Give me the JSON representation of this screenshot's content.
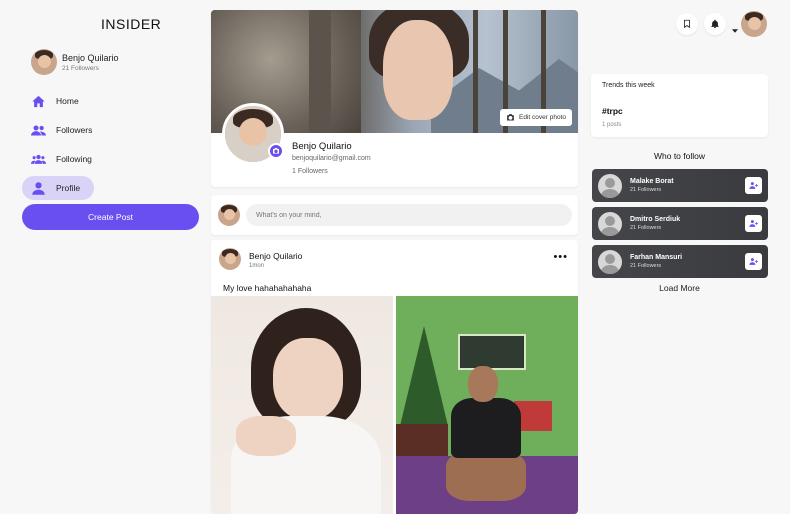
{
  "app": {
    "brand": "INSIDER"
  },
  "me": {
    "name": "Benjo Quilario",
    "followers": "21 Followers"
  },
  "nav": {
    "items": [
      {
        "label": "Home",
        "icon": "home-icon"
      },
      {
        "label": "Followers",
        "icon": "users-icon"
      },
      {
        "label": "Following",
        "icon": "user-group-icon"
      },
      {
        "label": "Profile",
        "icon": "user-icon",
        "active": true
      }
    ],
    "create_label": "Create Post"
  },
  "profile": {
    "name": "Benjo Quilario",
    "email": "benjoquilario@gmail.com",
    "followers": "1 Followers",
    "edit_cover_label": "Edit cover photo"
  },
  "compose": {
    "placeholder": "What's on your mind,"
  },
  "post": {
    "author": "Benjo Quilario",
    "time": "1mon",
    "more": "•••",
    "text": "My love hahahahahaha"
  },
  "trends": {
    "title": "Trends this week",
    "items": [
      {
        "tag": "#trpc",
        "count": "1 posts"
      }
    ]
  },
  "who_to_follow": {
    "title": "Who to follow",
    "items": [
      {
        "name": "Malake Borat",
        "followers": "21 Followers"
      },
      {
        "name": "Dmitro Serdiuk",
        "followers": "21 Followers"
      },
      {
        "name": "Farhan Mansuri",
        "followers": "21 Followers"
      }
    ],
    "load_more": "Load More"
  },
  "colors": {
    "accent": "#6a4ff0",
    "accent_soft": "#d9d3f7",
    "follow_card": "#3f4044"
  }
}
